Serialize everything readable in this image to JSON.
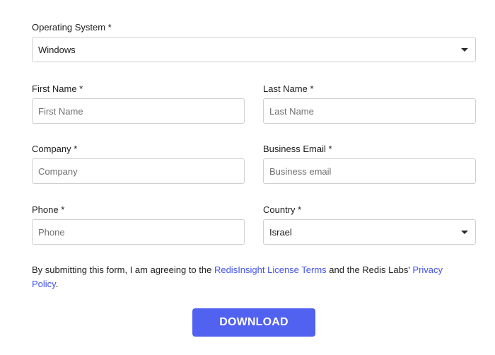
{
  "form": {
    "os": {
      "label": "Operating System *",
      "value": "Windows"
    },
    "first_name": {
      "label": "First Name *",
      "placeholder": "First Name"
    },
    "last_name": {
      "label": "Last Name *",
      "placeholder": "Last Name"
    },
    "company": {
      "label": "Company *",
      "placeholder": "Company"
    },
    "business_email": {
      "label": "Business Email *",
      "placeholder": "Business email"
    },
    "phone": {
      "label": "Phone *",
      "placeholder": "Phone"
    },
    "country": {
      "label": "Country *",
      "value": "Israel"
    },
    "consent": {
      "text_before": "By submitting this form, I am agreeing to the ",
      "license_link": "RedisInsight License Terms",
      "text_middle": " and the Redis Labs' ",
      "privacy_link": "Privacy Policy",
      "text_after": "."
    },
    "download_label": "DOWNLOAD"
  },
  "colors": {
    "accent": "#5161f0",
    "link": "#4353e8",
    "border": "#cfcfcf"
  }
}
